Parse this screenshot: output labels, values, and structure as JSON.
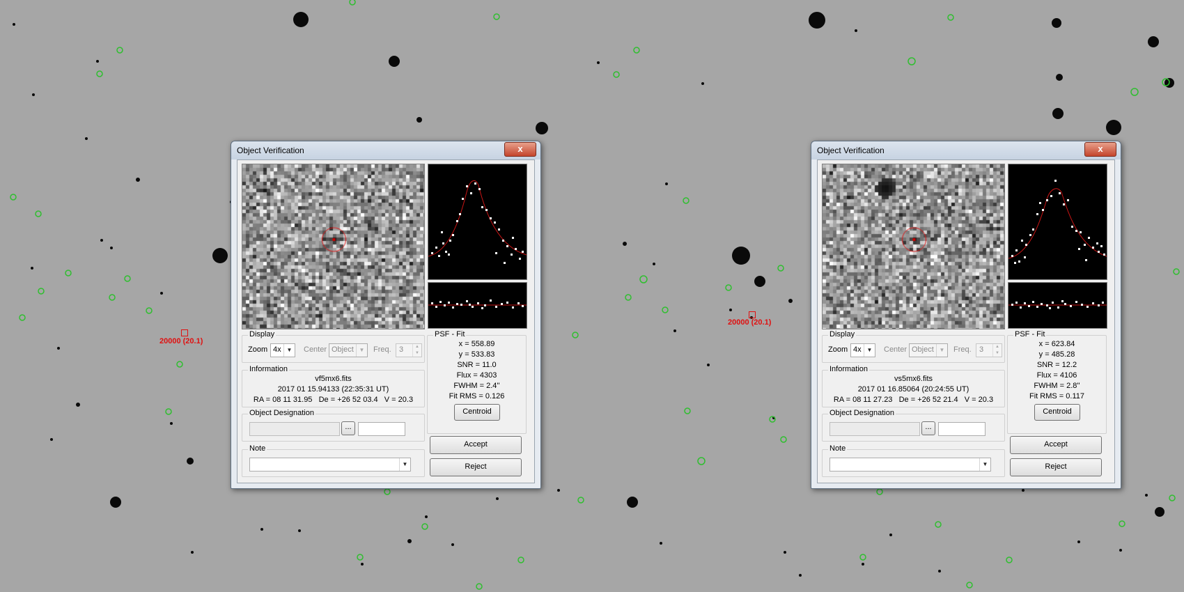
{
  "dialog_title": "Object Verification",
  "target_label": "20000 (20.1)",
  "close_symbol": "x",
  "panels": [
    {
      "display": {
        "group_label": "Display",
        "zoom_label": "Zoom",
        "zoom_value": "4x",
        "center_label": "Center",
        "center_value": "Object",
        "freq_label": "Freq.",
        "freq_value": "3"
      },
      "information": {
        "group_label": "Information",
        "filename": "vf5mx6.fits",
        "datetime": "2017 01 15.94133 (22:35:31 UT)",
        "coords": "RA = 08 11 31.95   De = +26 52 03.4   V = 20.3"
      },
      "designation": {
        "group_label": "Object Designation",
        "browse_label": "..."
      },
      "note": {
        "group_label": "Note"
      },
      "psf": {
        "group_label": "PSF - Fit",
        "x": "x = 558.89",
        "y": "y = 533.83",
        "snr": "SNR = 11.0",
        "flux": "Flux = 4303",
        "fwhm": "FWHM = 2.4''",
        "rms": "Fit RMS = 0.126",
        "centroid_label": "Centroid"
      },
      "accept_label": "Accept",
      "reject_label": "Reject"
    },
    {
      "display": {
        "group_label": "Display",
        "zoom_label": "Zoom",
        "zoom_value": "4x",
        "center_label": "Center",
        "center_value": "Object",
        "freq_label": "Freq.",
        "freq_value": "3"
      },
      "information": {
        "group_label": "Information",
        "filename": "vs5mx6.fits",
        "datetime": "2017 01 16.85064 (20:24:55 UT)",
        "coords": "RA = 08 11 27.23   De = +26 52 21.4   V = 20.3"
      },
      "designation": {
        "group_label": "Object Designation",
        "browse_label": "..."
      },
      "note": {
        "group_label": "Note"
      },
      "psf": {
        "group_label": "PSF - Fit",
        "x": "x = 623.84",
        "y": "y = 485.28",
        "snr": "SNR = 12.2",
        "flux": "Flux = 4106",
        "fwhm": "FWHM = 2.8''",
        "rms": "Fit RMS = 0.117",
        "centroid_label": "Centroid"
      },
      "accept_label": "Accept",
      "reject_label": "Reject"
    }
  ],
  "colors": {
    "sky": "#a6a6a6",
    "star": "#080808",
    "marker_green": "#2fbf2f",
    "target_red": "#e01010",
    "fit_curve": "#c81414"
  }
}
